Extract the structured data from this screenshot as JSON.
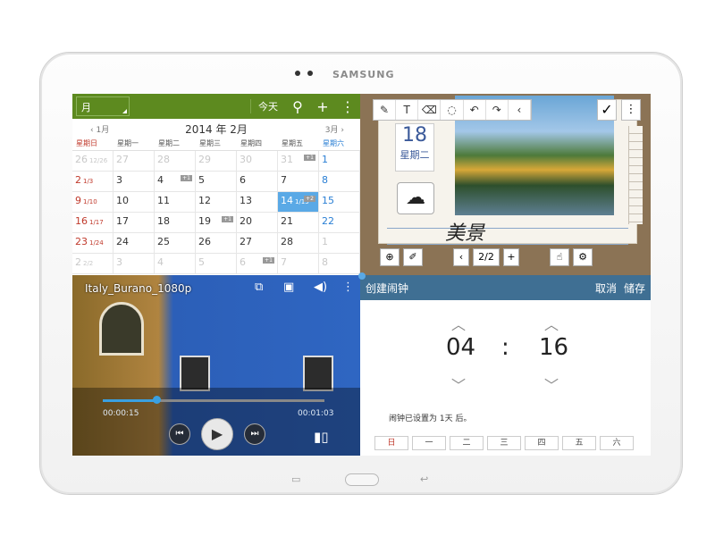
{
  "device": {
    "brand": "SAMSUNG"
  },
  "calendar": {
    "view_label": "月",
    "today_label": "今天",
    "icons": {
      "search": "search-icon",
      "add": "plus-icon",
      "more": "more-icon"
    },
    "month_title": "2014 年 2月",
    "prev_month": "1月",
    "next_month": "3月",
    "weekdays": [
      "星期日",
      "星期一",
      "星期二",
      "星期三",
      "星期四",
      "星期五",
      "星期六"
    ],
    "weeks": [
      [
        {
          "d": "26",
          "l": "12/26",
          "o": true
        },
        {
          "d": "27",
          "o": true
        },
        {
          "d": "28",
          "o": true
        },
        {
          "d": "29",
          "o": true
        },
        {
          "d": "30",
          "o": true
        },
        {
          "d": "31",
          "o": true,
          "b": "+1"
        },
        {
          "d": "1"
        }
      ],
      [
        {
          "d": "2",
          "l": "1/3"
        },
        {
          "d": "3"
        },
        {
          "d": "4",
          "b": "+1"
        },
        {
          "d": "5"
        },
        {
          "d": "6"
        },
        {
          "d": "7"
        },
        {
          "d": "8"
        }
      ],
      [
        {
          "d": "9",
          "l": "1/10"
        },
        {
          "d": "10"
        },
        {
          "d": "11"
        },
        {
          "d": "12"
        },
        {
          "d": "13"
        },
        {
          "d": "14",
          "l": "1/15",
          "sel": true,
          "b": "+2"
        },
        {
          "d": "15"
        }
      ],
      [
        {
          "d": "16",
          "l": "1/17"
        },
        {
          "d": "17"
        },
        {
          "d": "18"
        },
        {
          "d": "19",
          "b": "+1"
        },
        {
          "d": "20"
        },
        {
          "d": "21"
        },
        {
          "d": "22"
        }
      ],
      [
        {
          "d": "23",
          "l": "1/24"
        },
        {
          "d": "24"
        },
        {
          "d": "25"
        },
        {
          "d": "26"
        },
        {
          "d": "27"
        },
        {
          "d": "28"
        },
        {
          "d": "1",
          "o": true
        }
      ],
      [
        {
          "d": "2",
          "l": "2/2",
          "o": true
        },
        {
          "d": "3",
          "o": true
        },
        {
          "d": "4",
          "o": true
        },
        {
          "d": "5",
          "o": true
        },
        {
          "d": "6",
          "o": true,
          "b": "+1"
        },
        {
          "d": "7",
          "o": true
        },
        {
          "d": "8",
          "o": true
        }
      ]
    ],
    "accent": "#5d8a1f"
  },
  "memo": {
    "date_num": "18",
    "date_day": "星期二",
    "handwriting": "美景",
    "page": "2/2",
    "tools": [
      "pen-icon",
      "text-icon",
      "eraser-icon",
      "lasso-icon",
      "undo-icon",
      "redo-icon",
      "collapse-icon"
    ]
  },
  "video": {
    "title": "Italy_Burano_1080p",
    "elapsed": "00:00:15",
    "duration": "00:01:03",
    "progress": 0.24
  },
  "alarm": {
    "title": "创建闹钟",
    "cancel": "取消",
    "save": "储存",
    "hour": "04",
    "colon": ":",
    "minute": "16",
    "note": "闹钟已设置为 1天 后。",
    "days": [
      "日",
      "一",
      "二",
      "三",
      "四",
      "五",
      "六"
    ],
    "accent": "#3f6f93"
  }
}
